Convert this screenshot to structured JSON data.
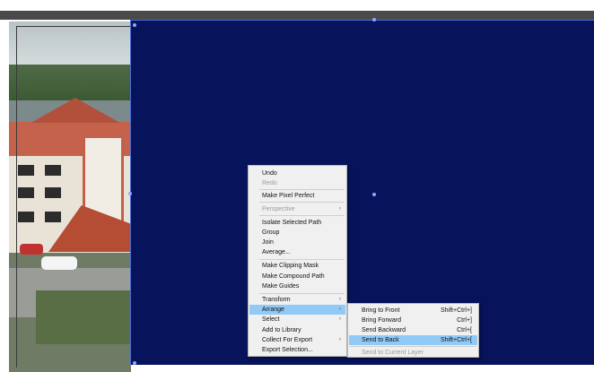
{
  "context_menu": {
    "items": [
      {
        "label": "Undo",
        "enabled": true
      },
      {
        "label": "Redo",
        "enabled": false
      },
      {
        "label": "Make Pixel Perfect",
        "enabled": true
      },
      {
        "label": "Perspective",
        "enabled": false,
        "submenu": true
      },
      {
        "label": "Isolate Selected Path",
        "enabled": true
      },
      {
        "label": "Group",
        "enabled": true
      },
      {
        "label": "Join",
        "enabled": true
      },
      {
        "label": "Average...",
        "enabled": true
      },
      {
        "label": "Make Clipping Mask",
        "enabled": true
      },
      {
        "label": "Make Compound Path",
        "enabled": true
      },
      {
        "label": "Make Guides",
        "enabled": true
      },
      {
        "label": "Transform",
        "enabled": true,
        "submenu": true
      },
      {
        "label": "Arrange",
        "enabled": true,
        "submenu": true,
        "highlighted": true
      },
      {
        "label": "Select",
        "enabled": true,
        "submenu": true
      },
      {
        "label": "Add to Library",
        "enabled": true
      },
      {
        "label": "Collect For Export",
        "enabled": true,
        "submenu": true
      },
      {
        "label": "Export Selection...",
        "enabled": true
      }
    ]
  },
  "arrange_submenu": {
    "items": [
      {
        "label": "Bring to Front",
        "shortcut": "Shift+Ctrl+]",
        "enabled": true
      },
      {
        "label": "Bring Forward",
        "shortcut": "Ctrl+]",
        "enabled": true
      },
      {
        "label": "Send Backward",
        "shortcut": "Ctrl+[",
        "enabled": true
      },
      {
        "label": "Send to Back",
        "shortcut": "Shift+Ctrl+[",
        "enabled": true,
        "highlighted": true
      },
      {
        "label": "Send to Current Layer",
        "shortcut": "",
        "enabled": false
      }
    ]
  },
  "icons": {
    "submenu_arrow": "chevron-right-icon"
  },
  "colors": {
    "selected_rect_fill": "#07135b",
    "selection_handle": "#8ea8ff",
    "menu_highlight": "#91c9f7",
    "menu_background": "#f0f0f0",
    "disabled_text": "#9a9a9a"
  }
}
